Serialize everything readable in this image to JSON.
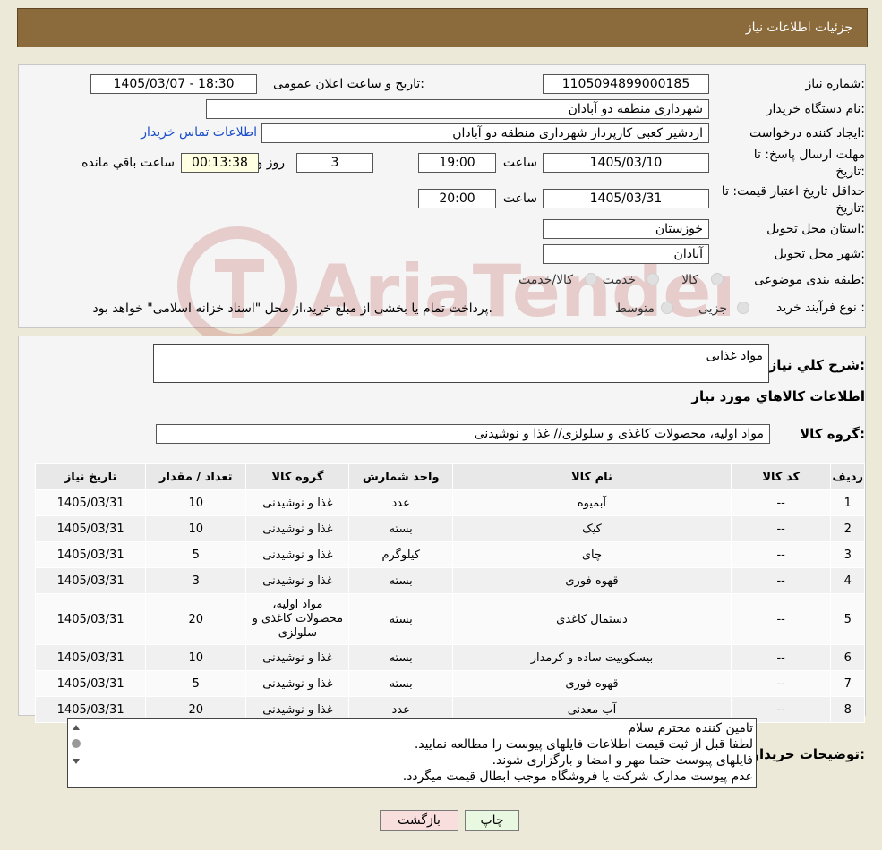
{
  "header": {
    "title": "جزئیات اطلاعات نیاز"
  },
  "watermark": {
    "text": "AriaTender.neT"
  },
  "info": {
    "need_number_label": "شماره نیاز:",
    "need_number": "1105094899000185",
    "announce_label": "تاریخ و ساعت اعلان عمومی:",
    "announce_value": "1405/03/07 - 18:30",
    "buyer_org_label": "نام دستگاه خریدار:",
    "buyer_org": "شهرداری منطقه دو آبادان",
    "creator_label": "ایجاد کننده درخواست:",
    "creator": "اردشیر کعبی کارپرداز شهرداری منطقه دو آبادان",
    "contact_link": "اطلاعات تماس خریدار",
    "deadline_label_1": "مهلت ارسال پاسخ: تا",
    "deadline_label_2": "تاریخ:",
    "deadline_date": "1405/03/10",
    "time_word": "ساعت",
    "deadline_time": "19:00",
    "days_value": "3",
    "days_word": "روز و",
    "remaining_value": "00:13:38",
    "remaining_word": "ساعت باقي مانده",
    "validity_label_1": "حداقل تاریخ اعتبار قیمت: تا",
    "validity_label_2": "تاریخ:",
    "validity_date": "1405/03/31",
    "validity_time": "20:00",
    "province_label": "استان محل تحویل:",
    "province": "خوزستان",
    "city_label": "شهر محل تحویل:",
    "city": "آبادان",
    "category_label": "طبقه بندی موضوعی:",
    "category_options": [
      "کالا",
      "خدمت",
      "کالا/خدمت"
    ],
    "process_label": "نوع فرآیند خرید :",
    "process_options": [
      "جزیی",
      "متوسط"
    ],
    "process_note": "پرداخت تمام یا بخشی از مبلغ خرید،از محل \"اسناد خزانه اسلامی\" خواهد بود."
  },
  "details": {
    "summary_label": "شرح كلي نياز:",
    "summary": "مواد غذایی",
    "goods_info_title": "اطلاعات كالاهاي مورد نياز",
    "group_label": "گروه كالا:",
    "group_value": "مواد اولیه، محصولات کاغذی و سلولزی// غذا و نوشیدنی",
    "columns": [
      "ردیف",
      "کد کالا",
      "نام کالا",
      "واحد شمارش",
      "گروه کالا",
      "تعداد / مقدار",
      "تاریخ نیاز"
    ],
    "rows": [
      {
        "n": "1",
        "code": "--",
        "name": "آبمیوه",
        "unit": "عدد",
        "group": "غذا و نوشیدنی",
        "qty": "10",
        "date": "1405/03/31"
      },
      {
        "n": "2",
        "code": "--",
        "name": "کیک",
        "unit": "بسته",
        "group": "غذا و نوشیدنی",
        "qty": "10",
        "date": "1405/03/31"
      },
      {
        "n": "3",
        "code": "--",
        "name": "چای",
        "unit": "کیلوگرم",
        "group": "غذا و نوشیدنی",
        "qty": "5",
        "date": "1405/03/31"
      },
      {
        "n": "4",
        "code": "--",
        "name": "قهوه فوری",
        "unit": "بسته",
        "group": "غذا و نوشیدنی",
        "qty": "3",
        "date": "1405/03/31"
      },
      {
        "n": "5",
        "code": "--",
        "name": "دستمال کاغذی",
        "unit": "بسته",
        "group": "مواد اولیه، محصولات کاغذی و سلولزی",
        "qty": "20",
        "date": "1405/03/31"
      },
      {
        "n": "6",
        "code": "--",
        "name": "بیسکوییت ساده و کرمدار",
        "unit": "بسته",
        "group": "غذا و نوشیدنی",
        "qty": "10",
        "date": "1405/03/31"
      },
      {
        "n": "7",
        "code": "--",
        "name": "قهوه فوری",
        "unit": "بسته",
        "group": "غذا و نوشیدنی",
        "qty": "5",
        "date": "1405/03/31"
      },
      {
        "n": "8",
        "code": "--",
        "name": "آب معدنی",
        "unit": "عدد",
        "group": "غذا و نوشیدنی",
        "qty": "20",
        "date": "1405/03/31"
      }
    ],
    "buyer_notes_label": "توضیحات خریدار:",
    "buyer_notes": [
      "تامین کننده محترم سلام",
      "لطفا قبل از ثبت قیمت اطلاعات فایلهای پیوست را مطالعه نمایید.",
      "فایلهای پیوست حتما مهر و امضا و بارگزاری شوند.",
      "عدم پیوست مدارک شرکت یا فروشگاه موجب ابطال قیمت میگردد."
    ]
  },
  "buttons": {
    "print": "چاپ",
    "back": "بازگشت"
  }
}
